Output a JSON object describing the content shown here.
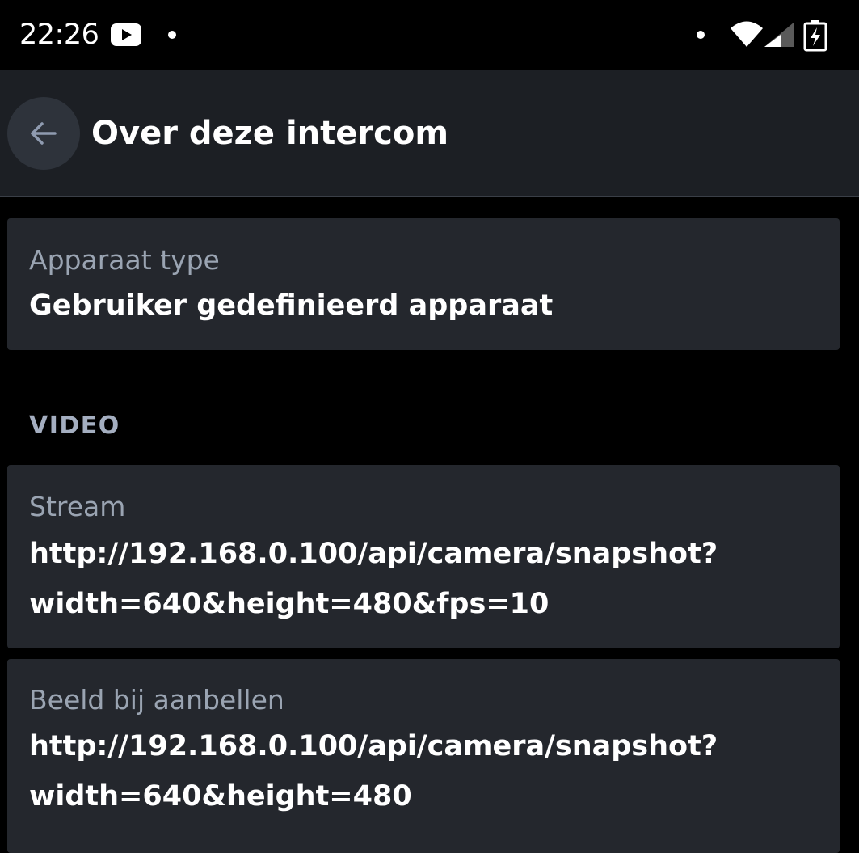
{
  "status_bar": {
    "time": "22:26",
    "icons": [
      "youtube-icon",
      "notification-dot",
      "notification-dot",
      "wifi-icon",
      "cell-signal-icon",
      "battery-charging-icon"
    ]
  },
  "header": {
    "title": "Over deze intercom",
    "back_icon": "arrow-left-icon"
  },
  "device": {
    "label": "Apparaat type",
    "value": "Gebruiker gedefinieerd apparaat"
  },
  "video_section": {
    "header": "VIDEO",
    "stream": {
      "label": "Stream",
      "value_line1": "http://192.168.0.100/api/camera/snapshot?",
      "value_line2": "width=640&height=480&fps=10"
    },
    "ring_image": {
      "label": "Beeld bij aanbellen",
      "value_line1": "http://192.168.0.100/api/camera/snapshot?",
      "value_line2": "width=640&height=480"
    }
  },
  "colors": {
    "background": "#000000",
    "app_bar": "#1c1f24",
    "card": "#24272d",
    "label": "#9aa4b2",
    "value": "#ffffff"
  }
}
